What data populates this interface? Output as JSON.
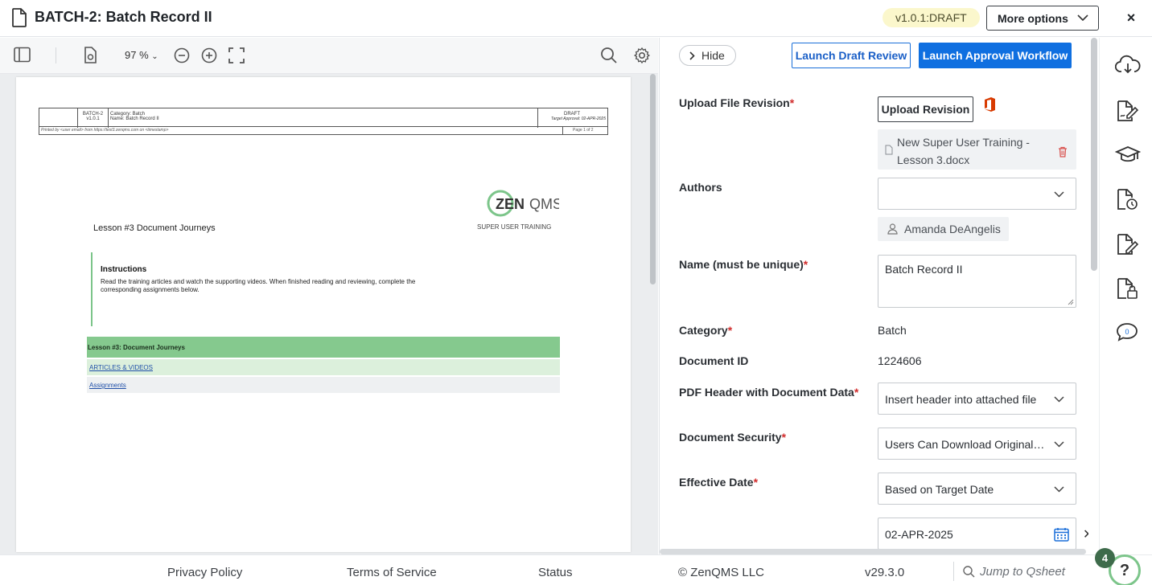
{
  "header": {
    "title": "BATCH-2: Batch Record II",
    "version_badge": "v1.0.1:DRAFT",
    "more_options": "More options",
    "close": "×"
  },
  "viewer": {
    "zoom": "97 %",
    "document": {
      "header_id": "BATCH-2",
      "header_version": "v1.0.1",
      "category_line": "Category: Batch",
      "name_line": "Name: Batch Record II",
      "status": "DRAFT",
      "target_approval": "Target Approval: 02-APR-2025",
      "printed_by": "Printed by <user email> from https://test3.zenqms.com on <timestamp>",
      "page_of": "Page 1 of 2",
      "logo_text": "ZENQMS",
      "logo_sub": "SUPER USER TRAINING",
      "lesson_title": "Lesson #3 Document Journeys",
      "instructions_head": "Instructions",
      "instructions_text": "Read the training articles and watch the supporting videos. When finished reading and reviewing, complete the corresponding assignments below.",
      "lesson_bar": "Lesson #3: Document Journeys",
      "link_articles": "ARTICLES & VIDEOS",
      "link_assignments": "Assignments"
    }
  },
  "panel": {
    "hide": "Hide",
    "launch_draft_review": "Launch Draft Review",
    "launch_approval_workflow": "Launch Approval Workflow",
    "upload_file_revision_label": "Upload File Revision",
    "upload_revision_button": "Upload Revision",
    "file_name": "New Super User Training - Lesson 3.docx",
    "authors_label": "Authors",
    "author_name": "Amanda DeAngelis",
    "name_label": "Name (must be unique)",
    "name_value": "Batch Record II",
    "category_label": "Category",
    "category_value": "Batch",
    "document_id_label": "Document ID",
    "document_id_value": "1224606",
    "pdf_header_label": "PDF Header with Document Data",
    "pdf_header_value": "Insert header into attached file",
    "document_security_label": "Document Security",
    "document_security_value": "Users Can Download Original File",
    "effective_date_label": "Effective Date",
    "effective_date_value": "Based on Target Date",
    "date_value": "02-APR-2025",
    "required_mark": "*"
  },
  "sidebar": {
    "icons": [
      "cloud-download-icon",
      "document-sign-icon",
      "graduation-cap-icon",
      "document-history-icon",
      "document-edit-icon",
      "document-lock-icon",
      "comments-icon"
    ],
    "comment_count": "0"
  },
  "footer": {
    "privacy": "Privacy Policy",
    "terms": "Terms of Service",
    "status": "Status",
    "copyright": "© ZenQMS LLC",
    "version": "v29.3.0",
    "jump_placeholder": "Jump to Qsheet",
    "notification_count": "4",
    "help": "?"
  },
  "colors": {
    "primary": "#0f6fe0",
    "brand_green": "#7cc58a",
    "required": "#d12c2c",
    "badge_bg": "#fbf7cc"
  }
}
